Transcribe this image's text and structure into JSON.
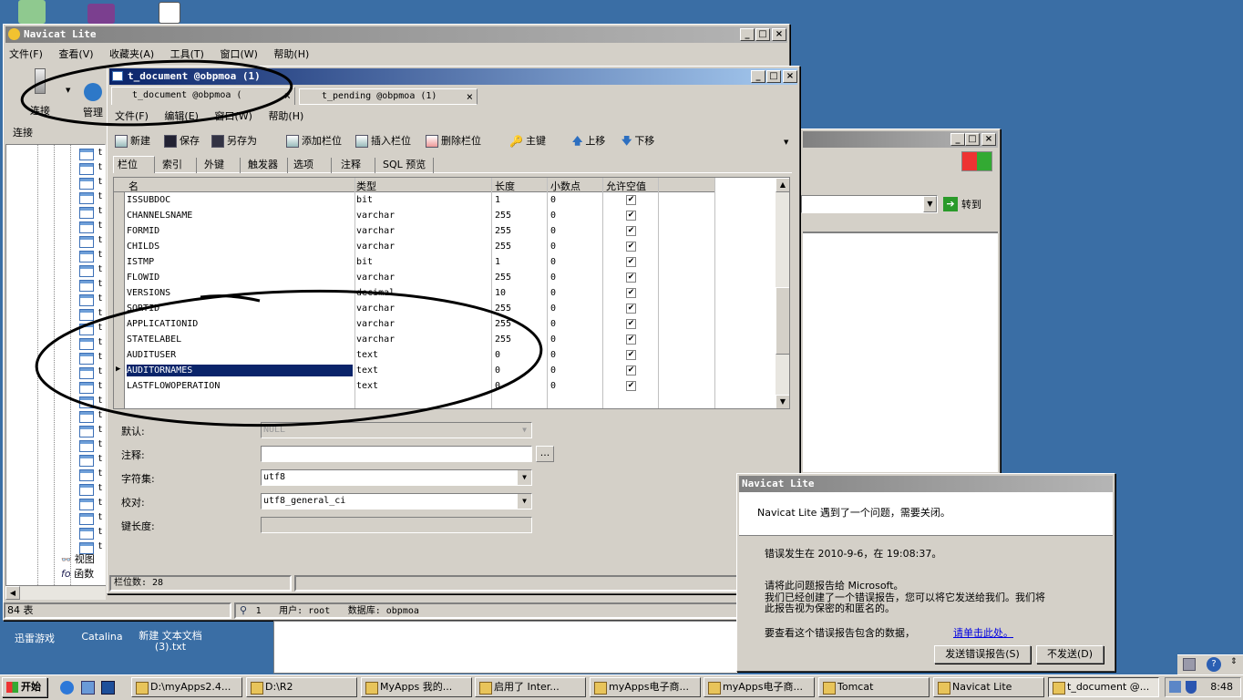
{
  "desktop": {
    "icons": [
      {
        "label": "迅雷游戏"
      },
      {
        "label": "Catalina"
      },
      {
        "label": "新建 文本文档 (3).txt"
      }
    ]
  },
  "main_window": {
    "title": "Navicat Lite",
    "menu": [
      "文件(F)",
      "查看(V)",
      "收藏夹(A)",
      "工具(T)",
      "窗口(W)",
      "帮助(H)"
    ],
    "toolbar": {
      "connect": "连接",
      "manage": "管理"
    },
    "connect_tab": "连接",
    "tree_items": [
      "t",
      "t",
      "t",
      "t",
      "t",
      "t",
      "t",
      "t",
      "t",
      "t",
      "t",
      "t",
      "t",
      "t",
      "t",
      "t",
      "t",
      "t",
      "t",
      "t",
      "t",
      "t",
      "t",
      "t",
      "t",
      "t",
      "t",
      "t"
    ],
    "tree_view": "视图",
    "tree_func": "函数",
    "status": {
      "tables": "84 表",
      "conn_count": "1",
      "user": "用户: root",
      "database": "数据库: obpmoa"
    }
  },
  "design_window": {
    "title": "t_document @obpmoa (1)",
    "tabs": [
      "t_document @obpmoa (",
      "t_pending @obpmoa (1)"
    ],
    "menu": [
      "文件(F)",
      "编辑(E)",
      "窗口(W)",
      "帮助(H)"
    ],
    "toolbar": {
      "new": "新建",
      "save": "保存",
      "save_as": "另存为",
      "add_field": "添加栏位",
      "insert_field": "插入栏位",
      "delete_field": "删除栏位",
      "primary_key": "主键",
      "move_up": "上移",
      "move_down": "下移"
    },
    "subtabs": [
      "栏位",
      "索引",
      "外键",
      "触发器",
      "选项",
      "注释",
      "SQL 预览"
    ],
    "grid_headers": [
      "名",
      "类型",
      "长度",
      "小数点",
      "允许空值"
    ],
    "rows": [
      {
        "name": "ISSUBDOC",
        "type": "bit",
        "length": "1",
        "decimals": "0",
        "allow_null": "✔"
      },
      {
        "name": "CHANNELSNAME",
        "type": "varchar",
        "length": "255",
        "decimals": "0",
        "allow_null": "✔"
      },
      {
        "name": "FORMID",
        "type": "varchar",
        "length": "255",
        "decimals": "0",
        "allow_null": "✔"
      },
      {
        "name": "CHILDS",
        "type": "varchar",
        "length": "255",
        "decimals": "0",
        "allow_null": "✔"
      },
      {
        "name": "ISTMP",
        "type": "bit",
        "length": "1",
        "decimals": "0",
        "allow_null": "✔"
      },
      {
        "name": "FLOWID",
        "type": "varchar",
        "length": "255",
        "decimals": "0",
        "allow_null": "✔"
      },
      {
        "name": "VERSIONS",
        "type": "decimal",
        "length": "10",
        "decimals": "0",
        "allow_null": "✔"
      },
      {
        "name": "SORTID",
        "type": "varchar",
        "length": "255",
        "decimals": "0",
        "allow_null": "✔"
      },
      {
        "name": "APPLICATIONID",
        "type": "varchar",
        "length": "255",
        "decimals": "0",
        "allow_null": "✔"
      },
      {
        "name": "STATELABEL",
        "type": "varchar",
        "length": "255",
        "decimals": "0",
        "allow_null": "✔"
      },
      {
        "name": "AUDITUSER",
        "type": "text",
        "length": "0",
        "decimals": "0",
        "allow_null": "✔"
      },
      {
        "name": "AUDITORNAMES",
        "type": "text",
        "length": "0",
        "decimals": "0",
        "allow_null": "✔"
      },
      {
        "name": "LASTFLOWOPERATION",
        "type": "text",
        "length": "0",
        "decimals": "0",
        "allow_null": "✔"
      }
    ],
    "selected_row": "AUDITORNAMES",
    "props": {
      "default_label": "默认:",
      "default_value": "NULL",
      "comment_label": "注释:",
      "comment_value": "",
      "charset_label": "字符集:",
      "charset_value": "utf8",
      "collation_label": "校对:",
      "collation_value": "utf8_general_ci",
      "keylen_label": "键长度:",
      "keylen_value": "",
      "ellipsis": "..."
    },
    "status": "栏位数: 28"
  },
  "browser_window": {
    "go_label": "转到"
  },
  "error_dialog": {
    "title": "Navicat Lite",
    "headline": "Navicat Lite 遇到了一个问题，需要关闭。",
    "occurred": "错误发生在 2010-9-6，在 19:08:37。",
    "report_lines": [
      "请将此问题报告给 Microsoft。",
      "我们已经创建了一个错误报告，您可以将它发送给我们。我们将",
      "此报告视为保密的和匿名的。"
    ],
    "view_data": "要查看这个错误报告包含的数据，",
    "link": "请单击此处。",
    "send_button": "发送错误报告(S)",
    "dont_send_button": "不发送(D)"
  },
  "taskbar": {
    "start": "开始",
    "tasks": [
      "D:\\myApps2.4...",
      "D:\\R2",
      "MyApps 我的...",
      "启用了 Inter...",
      "myApps电子商...",
      "myApps电子商...",
      "Tomcat",
      "Navicat Lite",
      "t_document @..."
    ],
    "clock": "8:48"
  },
  "colors": {
    "desktop": "#3a6ea5",
    "title_active": "#0a246a",
    "face": "#d4d0c8",
    "selection": "#0a246a"
  }
}
